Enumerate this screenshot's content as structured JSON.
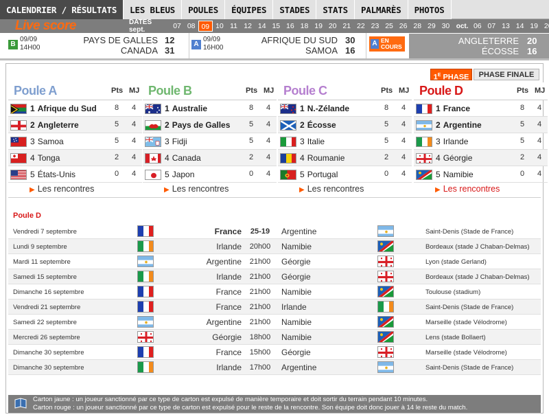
{
  "nav": [
    "CALENDRIER / RÉSULTATS",
    "LES BLEUS",
    "POULES",
    "ÉQUIPES",
    "STADES",
    "STATS",
    "PALMARÈS",
    "PHOTOS"
  ],
  "live": {
    "title": "Live score",
    "dates_label": "DATES sept.",
    "sept_days": [
      "07",
      "08",
      "09",
      "10",
      "11",
      "12",
      "14",
      "15",
      "16",
      "18",
      "19",
      "20",
      "21",
      "22",
      "23",
      "25",
      "26",
      "28",
      "29",
      "30"
    ],
    "current_day": "09",
    "oct_label": "oct.",
    "oct_days": [
      "06",
      "07",
      "13",
      "14",
      "19",
      "20"
    ],
    "matches": [
      {
        "group": "B",
        "date": "09/09",
        "time": "14H00",
        "team1": "PAYS DE GALLES",
        "score1": "12",
        "team2": "CANADA",
        "score2": "31"
      },
      {
        "group": "A",
        "date": "09/09",
        "time": "16H00",
        "team1": "AFRIQUE DU SUD",
        "score1": "30",
        "team2": "SAMOA",
        "score2": "16"
      }
    ],
    "encours": {
      "group": "A",
      "line1": "EN",
      "line2": "COURS",
      "team1": "ANGLETERRE",
      "score1": "20",
      "team2": "ÉCOSSE",
      "score2": "16"
    }
  },
  "phase_tabs": {
    "first_num": "1",
    "first_sup": "E",
    "first_label": "PHASE",
    "final": "PHASE FINALE"
  },
  "pools": [
    {
      "name": "Poule A",
      "pts_label": "Pts",
      "mj_label": "MJ",
      "link": "Les rencontres",
      "teams": [
        {
          "rank": "1",
          "name": "Afrique du Sud",
          "pts": "8",
          "mj": "4",
          "flag": "za"
        },
        {
          "rank": "2",
          "name": "Angleterre",
          "pts": "5",
          "mj": "4",
          "flag": "en"
        },
        {
          "rank": "3",
          "name": "Samoa",
          "pts": "5",
          "mj": "4",
          "flag": "ws"
        },
        {
          "rank": "4",
          "name": "Tonga",
          "pts": "2",
          "mj": "4",
          "flag": "to"
        },
        {
          "rank": "5",
          "name": "États-Unis",
          "pts": "0",
          "mj": "4",
          "flag": "us"
        }
      ]
    },
    {
      "name": "Poule B",
      "pts_label": "Pts",
      "mj_label": "MJ",
      "link": "Les rencontres",
      "teams": [
        {
          "rank": "1",
          "name": "Australie",
          "pts": "8",
          "mj": "4",
          "flag": "au"
        },
        {
          "rank": "2",
          "name": "Pays de Galles",
          "pts": "5",
          "mj": "4",
          "flag": "wa"
        },
        {
          "rank": "3",
          "name": "Fidji",
          "pts": "5",
          "mj": "4",
          "flag": "fj"
        },
        {
          "rank": "4",
          "name": "Canada",
          "pts": "2",
          "mj": "4",
          "flag": "ca"
        },
        {
          "rank": "5",
          "name": "Japon",
          "pts": "0",
          "mj": "4",
          "flag": "jp"
        }
      ]
    },
    {
      "name": "Poule C",
      "pts_label": "Pts",
      "mj_label": "MJ",
      "link": "Les rencontres",
      "teams": [
        {
          "rank": "1",
          "name": "N.-Zélande",
          "pts": "8",
          "mj": "4",
          "flag": "nz"
        },
        {
          "rank": "2",
          "name": "Écosse",
          "pts": "5",
          "mj": "4",
          "flag": "sc"
        },
        {
          "rank": "3",
          "name": "Italie",
          "pts": "5",
          "mj": "4",
          "flag": "it"
        },
        {
          "rank": "4",
          "name": "Roumanie",
          "pts": "2",
          "mj": "4",
          "flag": "ro"
        },
        {
          "rank": "5",
          "name": "Portugal",
          "pts": "0",
          "mj": "4",
          "flag": "pt"
        }
      ]
    },
    {
      "name": "Poule D",
      "pts_label": "Pts",
      "mj_label": "MJ",
      "link": "Les rencontres",
      "teams": [
        {
          "rank": "1",
          "name": "France",
          "pts": "8",
          "mj": "4",
          "flag": "fr"
        },
        {
          "rank": "2",
          "name": "Argentine",
          "pts": "5",
          "mj": "4",
          "flag": "ar"
        },
        {
          "rank": "3",
          "name": "Irlande",
          "pts": "5",
          "mj": "4",
          "flag": "ie"
        },
        {
          "rank": "4",
          "name": "Géorgie",
          "pts": "2",
          "mj": "4",
          "flag": "ge"
        },
        {
          "rank": "5",
          "name": "Namibie",
          "pts": "0",
          "mj": "4",
          "flag": "na"
        }
      ]
    }
  ],
  "fixtures_title": "Poule D",
  "fixtures": [
    {
      "date": "Vendredi 7 septembre",
      "home": "France",
      "home_flag": "fr",
      "score": "25-19",
      "played": true,
      "away": "Argentine",
      "away_flag": "ar",
      "venue": "Saint-Denis (Stade de France)"
    },
    {
      "date": "Lundi 9 septembre",
      "home": "Irlande",
      "home_flag": "ie",
      "score": "20h00",
      "played": false,
      "away": "Namibie",
      "away_flag": "na",
      "venue": "Bordeaux (stade J Chaban-Delmas)"
    },
    {
      "date": "Mardi 11 septembre",
      "home": "Argentine",
      "home_flag": "ar",
      "score": "21h00",
      "played": false,
      "away": "Géorgie",
      "away_flag": "ge",
      "venue": "Lyon (stade Gerland)"
    },
    {
      "date": "Samedi 15 septembre",
      "home": "Irlande",
      "home_flag": "ie",
      "score": "21h00",
      "played": false,
      "away": "Géorgie",
      "away_flag": "ge",
      "venue": "Bordeaux (stade J Chaban-Delmas)"
    },
    {
      "date": "Dimanche 16 septembre",
      "home": "France",
      "home_flag": "fr",
      "score": "21h00",
      "played": false,
      "away": "Namibie",
      "away_flag": "na",
      "venue": "Toulouse (stadium)"
    },
    {
      "date": "Vendredi 21 septembre",
      "home": "France",
      "home_flag": "fr",
      "score": "21h00",
      "played": false,
      "away": "Irlande",
      "away_flag": "ie",
      "venue": "Saint-Denis (Stade de France)"
    },
    {
      "date": "Samedi 22 septembre",
      "home": "Argentine",
      "home_flag": "ar",
      "score": "21h00",
      "played": false,
      "away": "Namibie",
      "away_flag": "na",
      "venue": "Marseille (stade Vélodrome)"
    },
    {
      "date": "Mercredi 26 septembre",
      "home": "Géorgie",
      "home_flag": "ge",
      "score": "18h00",
      "played": false,
      "away": "Namibie",
      "away_flag": "na",
      "venue": "Lens (stade Bollaert)"
    },
    {
      "date": "Dimanche 30 septembre",
      "home": "France",
      "home_flag": "fr",
      "score": "15h00",
      "played": false,
      "away": "Géorgie",
      "away_flag": "ge",
      "venue": "Marseille (stade Vélodrome)"
    },
    {
      "date": "Dimanche 30 septembre",
      "home": "Irlande",
      "home_flag": "ie",
      "score": "17h00",
      "played": false,
      "away": "Argentine",
      "away_flag": "ar",
      "venue": "Saint-Denis (Stade de France)"
    }
  ],
  "footer": {
    "line1": "Carton jaune : un joueur sanctionné par ce type de carton est expulsé de manière temporaire et doit sortir du terrain pendant 10 minutes.",
    "line2": "Carton rouge : un joueur sanctionné par ce type de carton est expulsé pour le reste de la rencontre. Son équipe doit donc jouer à 14 le reste du match."
  },
  "colors": {
    "accent": "#ff5a00",
    "pool_a": "#7f9fcf",
    "pool_b": "#6fb76f",
    "pool_c": "#b57fcf",
    "pool_d": "#d81818",
    "bar": "#7d7d7d"
  }
}
